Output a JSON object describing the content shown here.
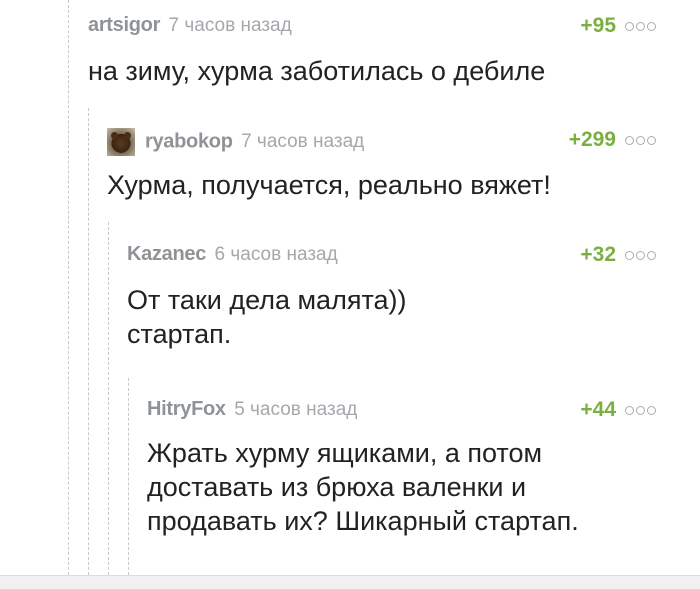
{
  "comments": [
    {
      "author": "artsigor",
      "time": "7 часов назад",
      "rating": "+95",
      "text": "на зиму, хурма заботилась о дебиле"
    },
    {
      "author": "ryabokop",
      "time": "7 часов назад",
      "rating": "+299",
      "text": "Хурма, получается, реально вяжет!"
    },
    {
      "author": "Kazanec",
      "time": "6 часов назад",
      "rating": "+32",
      "text": "От таки дела малята))\nстартап."
    },
    {
      "author": "HitryFox",
      "time": "5 часов назад",
      "rating": "+44",
      "text": "Жрать хурму ящиками, а потом\nдоставать из брюха валенки и\nпродавать их? Шикарный стартап."
    }
  ],
  "colors": {
    "author": "#8f9398",
    "time": "#a4a8ac",
    "rating_positive": "#7ab03f",
    "thread_line": "#c9c9c9"
  },
  "icons": {
    "more": "three-circles-more-icon",
    "avatar": "bear-avatar"
  }
}
